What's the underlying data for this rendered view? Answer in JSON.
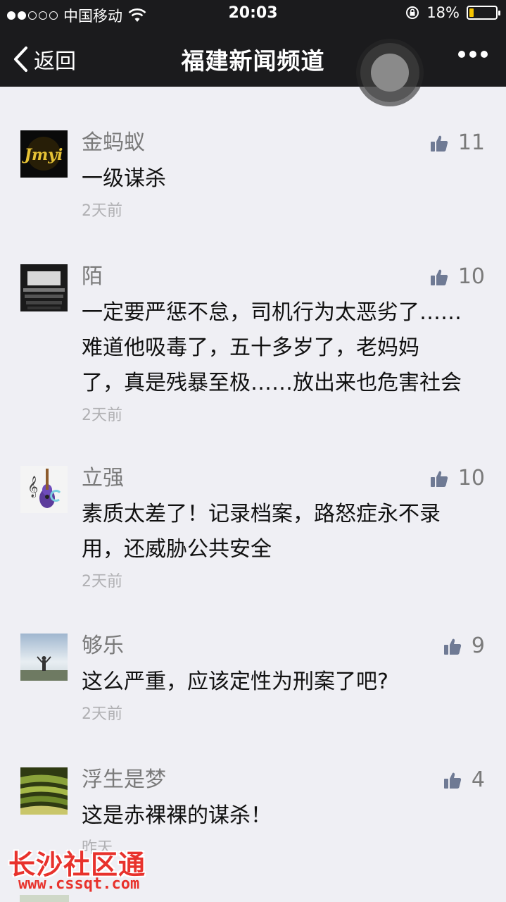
{
  "status_bar": {
    "carrier": "中国移动",
    "time": "20:03",
    "battery": "18%",
    "battery_level": 0.18,
    "signal_bars_filled": 2,
    "signal_bars_total": 5
  },
  "nav": {
    "back_label": "返回",
    "title": "福建新闻频道"
  },
  "colors": {
    "bar_bg": "#1b1b1d",
    "page_bg": "#efeff4",
    "like_icon": "#6f7a94",
    "watermark": "#e8322c"
  },
  "comments": [
    {
      "name": "金蚂蚁",
      "text": "一级谋杀",
      "time": "2天前",
      "likes": "11",
      "avatar_icon": "jmyi-logo-avatar"
    },
    {
      "name": "陌",
      "text": "一定要严惩不怠，司机行为太恶劣了……\n难道他吸毒了，五十多岁了，老妈妈\n了，真是残暴至极……放出来也危害社会",
      "time": "2天前",
      "likes": "10",
      "avatar_icon": "theater-avatar"
    },
    {
      "name": "立强",
      "text": "素质太差了！记录档案，路怒症永不录\n用，还威胁公共安全",
      "time": "2天前",
      "likes": "10",
      "avatar_icon": "guitar-avatar"
    },
    {
      "name": "够乐",
      "text": "这么严重，应该定性为刑案了吧?",
      "time": "2天前",
      "likes": "9",
      "avatar_icon": "sky-person-avatar"
    },
    {
      "name": "浮生是梦",
      "text": "这是赤裸裸的谋杀！",
      "time": "昨天",
      "likes": "4",
      "avatar_icon": "terraced-field-avatar"
    }
  ],
  "watermark": {
    "text": "长沙社区通",
    "url": "www.cssqt.com"
  }
}
